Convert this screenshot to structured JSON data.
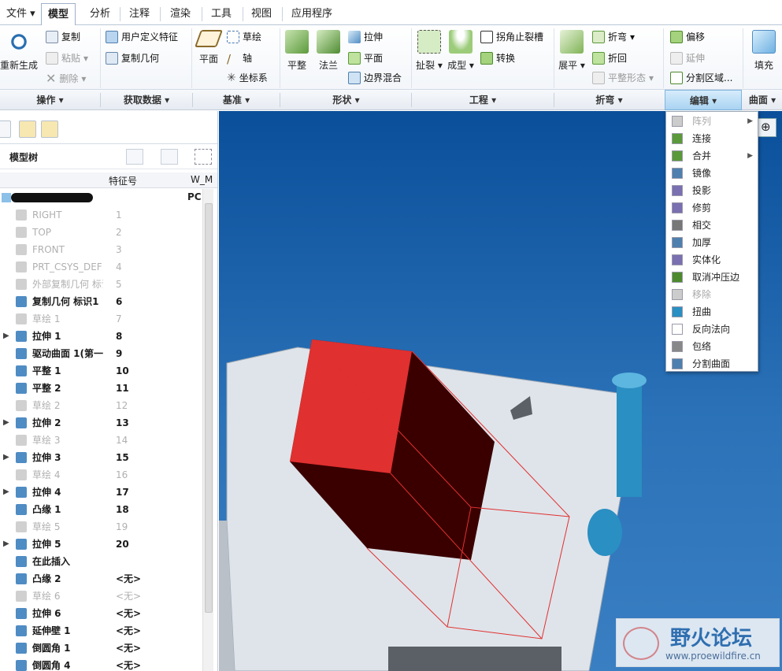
{
  "tabs": [
    "文件",
    "模型",
    "分析",
    "注释",
    "渲染",
    "工具",
    "视图",
    "应用程序"
  ],
  "ribbon": {
    "operations": {
      "regen": "重新生成",
      "copy": "复制",
      "paste": "粘贴",
      "delete": "删除"
    },
    "get_data": {
      "udf": "用户定义特征",
      "copy_geom": "复制几何"
    },
    "datum": {
      "plane": "平面",
      "sketch": "草绘",
      "axis": "轴",
      "csys": "坐标系"
    },
    "shapes": {
      "flat": "平整",
      "flange": "法兰",
      "extrude": "拉伸",
      "planar": "平面",
      "boundary_blend": "边界混合"
    },
    "engineering": {
      "rip": "扯裂",
      "form": "成型",
      "corner_relief": "拐角止裂槽",
      "convert": "转换"
    },
    "bend": {
      "unbend": "展平",
      "bend": "折弯",
      "bend_back": "折回",
      "flat_form": "平整形态"
    },
    "editing": {
      "offset": "偏移",
      "extend": "延伸",
      "split_area": "分割区域..."
    },
    "surfaces": {
      "fill": "填充"
    }
  },
  "groups": [
    "操作",
    "获取数据",
    "基准",
    "形状",
    "工程",
    "折弯",
    "编辑",
    "曲面"
  ],
  "model_tree": {
    "title": "模型树",
    "col_feature_id": "特征号",
    "col_extra": "W_M",
    "root_suffix": "PC",
    "rows": [
      {
        "name": "RIGHT",
        "id": "1",
        "state": "dim",
        "expand": false
      },
      {
        "name": "TOP",
        "id": "2",
        "state": "dim",
        "expand": false
      },
      {
        "name": "FRONT",
        "id": "3",
        "state": "dim",
        "expand": false
      },
      {
        "name": "PRT_CSYS_DEF",
        "id": "4",
        "state": "dim",
        "expand": false
      },
      {
        "name": "外部复制几何 标识",
        "id": "5",
        "state": "dim",
        "expand": false
      },
      {
        "name": "复制几何 标识1",
        "id": "6",
        "state": "bold",
        "expand": false
      },
      {
        "name": "草绘 1",
        "id": "7",
        "state": "dim",
        "expand": false
      },
      {
        "name": "拉伸 1",
        "id": "8",
        "state": "bold",
        "expand": true
      },
      {
        "name": "驱动曲面 1(第一",
        "id": "9",
        "state": "bold",
        "expand": false
      },
      {
        "name": "平整 1",
        "id": "10",
        "state": "bold",
        "expand": false
      },
      {
        "name": "平整 2",
        "id": "11",
        "state": "bold",
        "expand": false
      },
      {
        "name": "草绘 2",
        "id": "12",
        "state": "dim",
        "expand": false
      },
      {
        "name": "拉伸 2",
        "id": "13",
        "state": "bold",
        "expand": true
      },
      {
        "name": "草绘 3",
        "id": "14",
        "state": "dim",
        "expand": false
      },
      {
        "name": "拉伸 3",
        "id": "15",
        "state": "bold",
        "expand": true
      },
      {
        "name": "草绘 4",
        "id": "16",
        "state": "dim",
        "expand": false
      },
      {
        "name": "拉伸 4",
        "id": "17",
        "state": "bold",
        "expand": true
      },
      {
        "name": "凸缘 1",
        "id": "18",
        "state": "bold",
        "expand": false
      },
      {
        "name": "草绘 5",
        "id": "19",
        "state": "dim",
        "expand": false
      },
      {
        "name": "拉伸 5",
        "id": "20",
        "state": "bold",
        "expand": true
      },
      {
        "name": "在此插入",
        "id": "",
        "state": "bold",
        "expand": false
      },
      {
        "name": "凸缘 2",
        "id": "<无>",
        "state": "bold",
        "expand": false
      },
      {
        "name": "草绘 6",
        "id": "<无>",
        "state": "dim",
        "expand": false
      },
      {
        "name": "拉伸 6",
        "id": "<无>",
        "state": "bold",
        "expand": false
      },
      {
        "name": "延伸壁 1",
        "id": "<无>",
        "state": "bold",
        "expand": false
      },
      {
        "name": "倒圆角 1",
        "id": "<无>",
        "state": "bold",
        "expand": false
      },
      {
        "name": "倒圆角 4",
        "id": "<无>",
        "state": "bold",
        "expand": false
      }
    ]
  },
  "menu": [
    {
      "label": "阵列",
      "disabled": true,
      "submenu": true
    },
    {
      "label": "连接",
      "disabled": false,
      "submenu": false
    },
    {
      "label": "合并",
      "disabled": false,
      "submenu": true
    },
    {
      "label": "镜像",
      "disabled": false,
      "submenu": false
    },
    {
      "label": "投影",
      "disabled": false,
      "submenu": false
    },
    {
      "label": "修剪",
      "disabled": false,
      "submenu": false
    },
    {
      "label": "相交",
      "disabled": false,
      "submenu": false
    },
    {
      "label": "加厚",
      "disabled": false,
      "submenu": false
    },
    {
      "label": "实体化",
      "disabled": false,
      "submenu": false
    },
    {
      "label": "取消冲压边",
      "disabled": false,
      "submenu": false
    },
    {
      "label": "移除",
      "disabled": true,
      "submenu": false
    },
    {
      "label": "扭曲",
      "disabled": false,
      "submenu": false
    },
    {
      "label": "反向法向",
      "disabled": false,
      "submenu": false
    },
    {
      "label": "包络",
      "disabled": false,
      "submenu": false
    },
    {
      "label": "分割曲面",
      "disabled": false,
      "submenu": false
    }
  ],
  "watermark": {
    "title": "野火论坛",
    "url": "www.proewildfire.cn"
  },
  "colors": {
    "viewport_top": "#0a4f9a",
    "part_red": "#e03030",
    "part_dark": "#3a0000",
    "sheet": "#dfe4ea",
    "accent": "#2b72b8"
  }
}
